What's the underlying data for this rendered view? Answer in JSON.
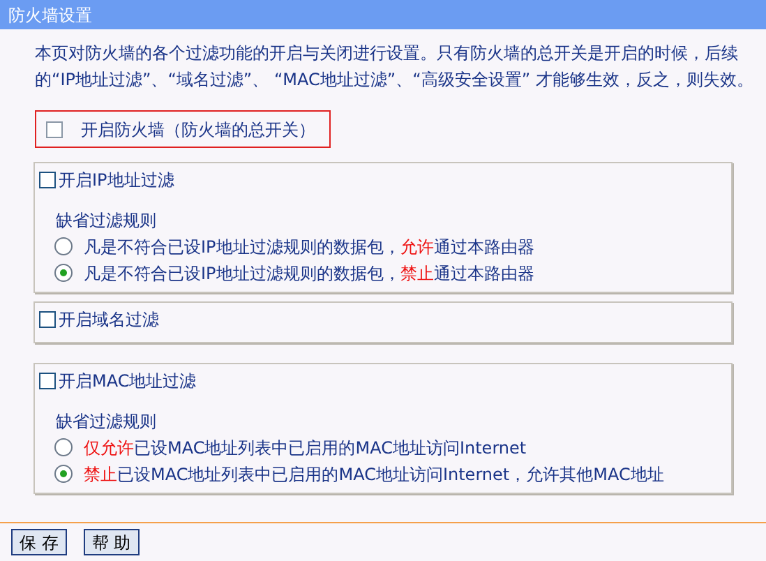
{
  "title": "防火墙设置",
  "intro": "本页对防火墙的各个过滤功能的开启与关闭进行设置。只有防火墙的总开关是开启的时候，后续的“IP地址过滤”、“域名过滤”、 “MAC地址过滤”、“高级安全设置” 才能够生效，反之，则失效。",
  "master_switch": {
    "label": "开启防火墙（防火墙的总开关）",
    "checked": false
  },
  "sections": [
    {
      "label": "开启IP地址过滤",
      "checked": false,
      "rules_label": "缺省过滤规则",
      "rules": [
        {
          "before": "凡是不符合已设IP地址过滤规则的数据包，",
          "highlight": "允许",
          "after": "通过本路由器",
          "selected": false
        },
        {
          "before": "凡是不符合已设IP地址过滤规则的数据包，",
          "highlight": "禁止",
          "after": "通过本路由器",
          "selected": true
        }
      ]
    },
    {
      "label": "开启域名过滤",
      "checked": false
    },
    {
      "label": "开启MAC地址过滤",
      "checked": false,
      "rules_label": "缺省过滤规则",
      "rules": [
        {
          "highlight": "仅允许",
          "after": "已设MAC地址列表中已启用的MAC地址访问Internet",
          "selected": false
        },
        {
          "highlight": "禁止",
          "after": "已设MAC地址列表中已启用的MAC地址访问Internet，允许其他MAC地址",
          "selected": true
        }
      ]
    }
  ],
  "buttons": [
    "保 存",
    "帮 助"
  ]
}
